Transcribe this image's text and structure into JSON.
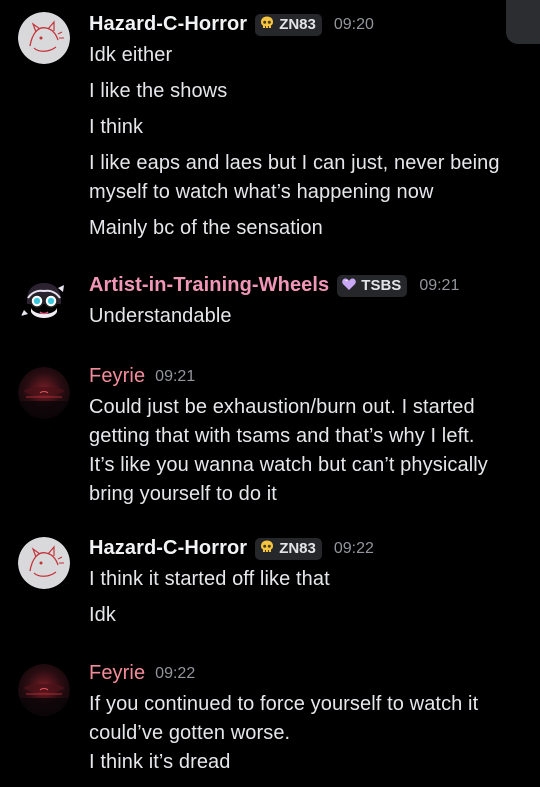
{
  "colors": {
    "hazard_name": "#f2f3f5",
    "artist_name": "#f296b8",
    "feyrie_name": "#f28c9a",
    "tag_bg": "#26272b",
    "background": "#000000"
  },
  "messages": [
    {
      "username": "Hazard-C-Horror",
      "tag_icon": "skull-icon",
      "tag": "ZN83",
      "time": "09:20",
      "lines": [
        "Idk either",
        "I like the shows",
        "I think",
        "I like eaps and laes but I can just, never being",
        "myself to watch what’s happening now",
        "Mainly bc of the sensation"
      ]
    },
    {
      "username": "Artist-in-Training-Wheels",
      "tag_icon": "heart-icon",
      "tag": "TSBS",
      "time": "09:21",
      "lines": [
        "Understandable"
      ]
    },
    {
      "username": "Feyrie",
      "time": "09:21",
      "lines": [
        "Could just be exhaustion/burn out. I started",
        "getting that with tsams and that’s why I left.",
        "It’s like you wanna watch but can’t physically",
        "bring yourself to do it"
      ]
    },
    {
      "username": "Hazard-C-Horror",
      "tag_icon": "skull-icon",
      "tag": "ZN83",
      "time": "09:22",
      "lines": [
        "I think it started off like that",
        "Idk"
      ]
    },
    {
      "username": "Feyrie",
      "time": "09:22",
      "lines": [
        "If you continued to force yourself to watch it",
        "could’ve gotten worse.",
        "I think it’s dread"
      ]
    }
  ]
}
